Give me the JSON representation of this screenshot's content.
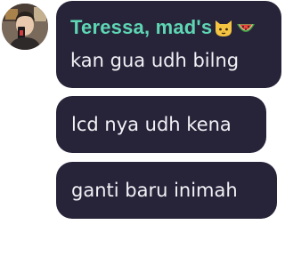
{
  "sender": {
    "name": "Teressa, mad's",
    "name_color": "#5ed6b3",
    "emojis": [
      "cat-face-emoji",
      "watermelon-emoji"
    ]
  },
  "messages": [
    {
      "text": "kan gua udh bilng"
    },
    {
      "text": "lcd nya udh kena"
    },
    {
      "text": "ganti baru inimah"
    }
  ],
  "colors": {
    "bubble": "#27243a",
    "message_text": "#f2f1f5",
    "background": "#ffffff"
  }
}
